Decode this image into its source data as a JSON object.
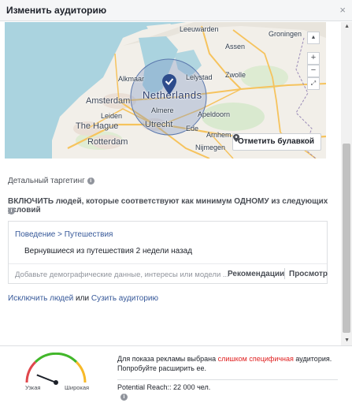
{
  "dialog": {
    "title": "Изменить аудиторию",
    "close": "×"
  },
  "map": {
    "labels": {
      "country": "Netherlands",
      "amsterdam": "Amsterdam",
      "hague": "The Hague",
      "rotterdam": "Rotterdam",
      "utrecht": "Utrecht",
      "leeuwarden": "Leeuwarden",
      "assen": "Assen",
      "zwolle": "Zwolle",
      "apeldoorn": "Apeldoorn",
      "nijmegen": "Nijmegen",
      "almere": "Almere",
      "alkmaar": "Alkmaar",
      "leiden": "Leiden",
      "lelystad": "Lelystad",
      "groningen": "Groningen",
      "ede": "Ede",
      "arnhem": "Arnhem"
    },
    "zoom_in": "+",
    "zoom_out": "−",
    "pin_button": "Отметить булавкой"
  },
  "targeting": {
    "label": "Детальный таргетинг",
    "include_text": "ВКЛЮЧИТЬ людей, которые соответствуют как минимум ОДНОМУ из следующих условий",
    "breadcrumb": "Поведение > Путешествия",
    "interest": "Вернувшиеся из путешествия 2 недели назад",
    "input_placeholder": "Добавьте демографические данные, интересы или модели ...",
    "recommendations": "Рекомендации",
    "browse": "Просмотр"
  },
  "links": {
    "exclude": "Исключить людей",
    "or": " или ",
    "narrow": "Сузить аудиторию"
  },
  "footer": {
    "gauge_narrow": "Узкая",
    "gauge_broad": "Широкая",
    "gauge_level": 0.12,
    "msg_prefix": "Для показа рекламы выбрана ",
    "msg_warn": "слишком специфичная",
    "msg_suffix": " аудитория. Попробуйте расширить ее.",
    "reach": "Potential Reach:: 22 000 чел."
  },
  "colors": {
    "link": "#365899",
    "warn": "#e02020",
    "gauge_red": "#e0474c",
    "gauge_green": "#42b72a",
    "gauge_orange": "#f7b928"
  }
}
